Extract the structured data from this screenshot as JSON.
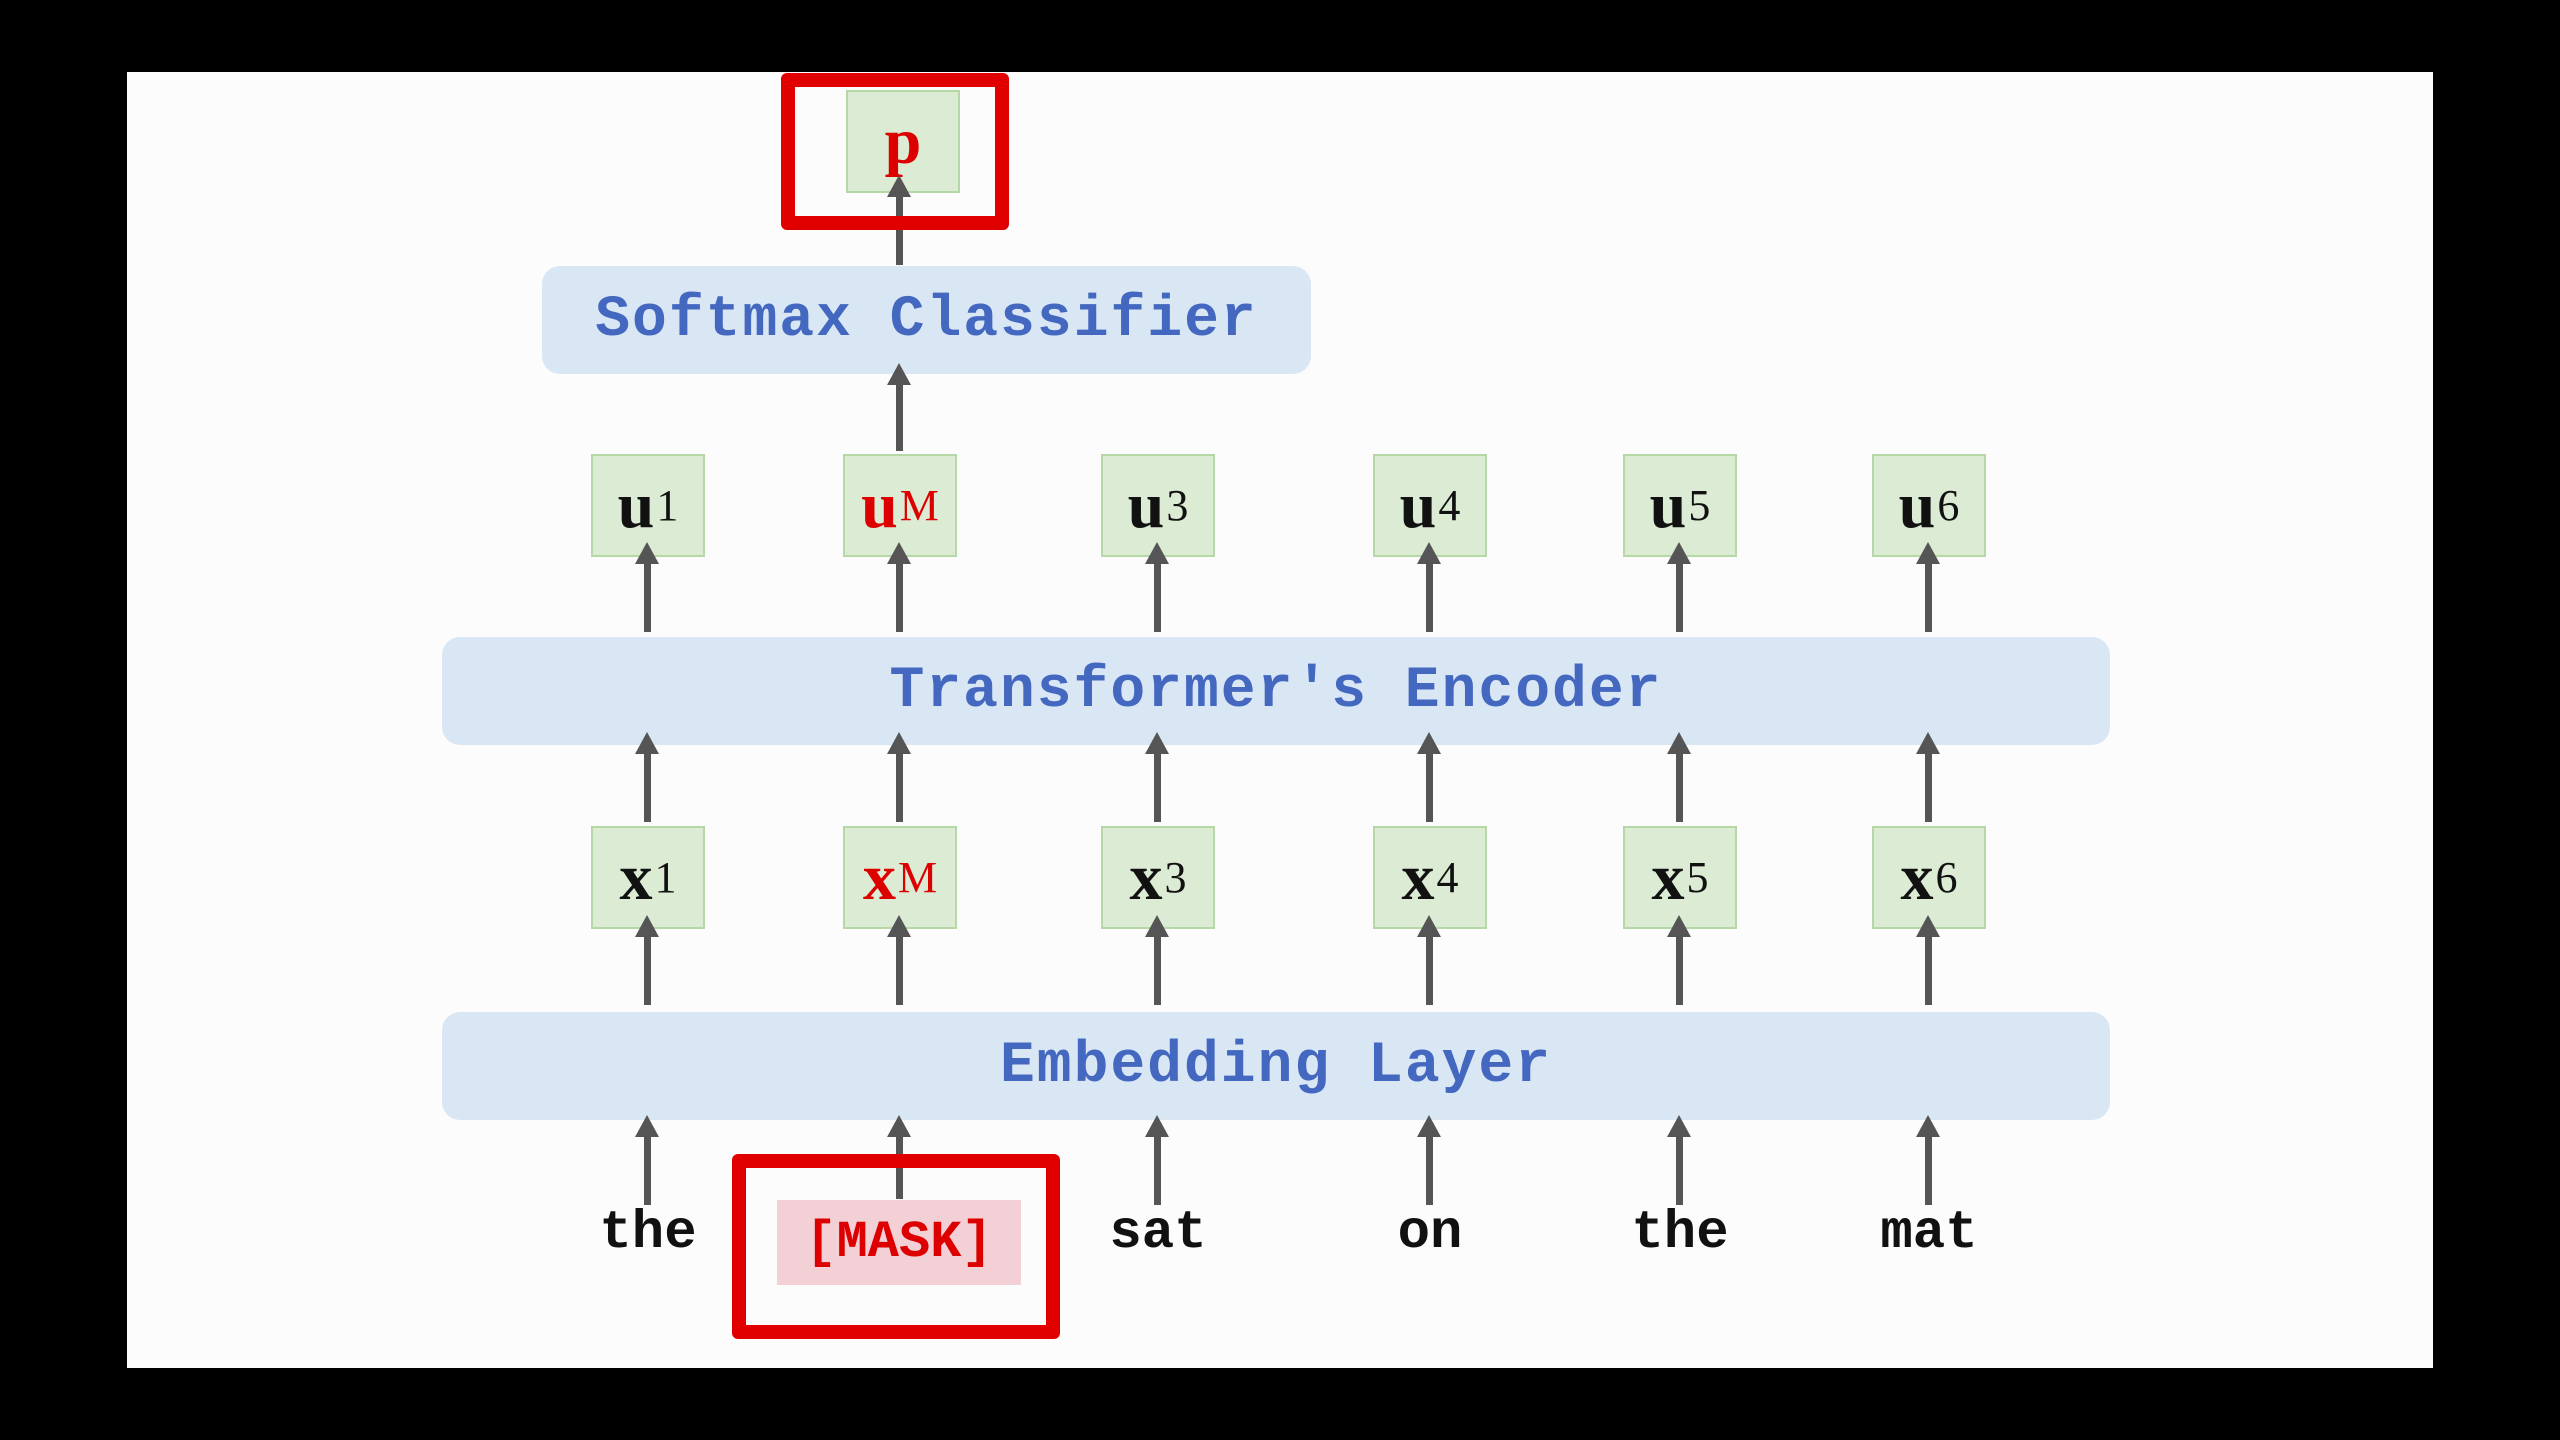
{
  "layers": {
    "softmax": "Softmax Classifier",
    "encoder": "Transformer's Encoder",
    "embedding": "Embedding Layer"
  },
  "output": {
    "label": "p",
    "highlighted": true
  },
  "columns": [
    {
      "u": "u",
      "u_sub": "1",
      "x": "x",
      "x_sub": "1",
      "word": "the",
      "masked": false
    },
    {
      "u": "u",
      "u_sub": "M",
      "x": "x",
      "x_sub": "M",
      "word": "[MASK]",
      "masked": true
    },
    {
      "u": "u",
      "u_sub": "3",
      "x": "x",
      "x_sub": "3",
      "word": "sat",
      "masked": false
    },
    {
      "u": "u",
      "u_sub": "4",
      "x": "x",
      "x_sub": "4",
      "word": "on",
      "masked": false
    },
    {
      "u": "u",
      "u_sub": "5",
      "x": "x",
      "x_sub": "5",
      "word": "the",
      "masked": false
    },
    {
      "u": "u",
      "u_sub": "6",
      "x": "x",
      "x_sub": "6",
      "word": "mat",
      "masked": false
    }
  ],
  "colors": {
    "highlight": "#e00000",
    "layer_text": "#4468c0",
    "layer_bg": "#d9e7f4",
    "box_bg": "#dcebd3",
    "mask_bg": "#f2d0d5"
  }
}
